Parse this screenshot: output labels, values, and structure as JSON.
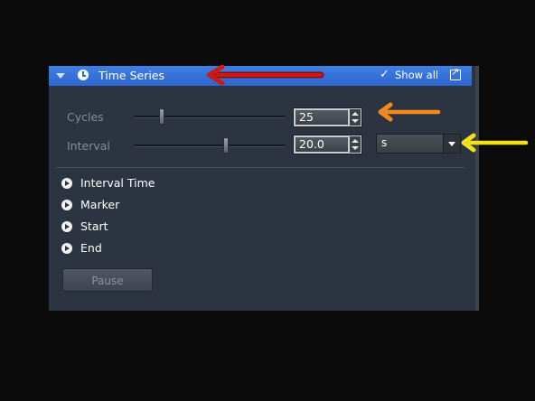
{
  "header": {
    "title": "Time Series",
    "show_all_check": "✓",
    "show_all_label": "Show all",
    "icons": [
      "collapse-triangle-icon",
      "clock-icon",
      "undock-icon"
    ]
  },
  "cycles": {
    "label": "Cycles",
    "value": "25"
  },
  "interval": {
    "label": "Interval",
    "value": "20.0",
    "unit": "s"
  },
  "sections": [
    {
      "label": "Interval Time"
    },
    {
      "label": "Marker"
    },
    {
      "label": "Start"
    },
    {
      "label": "End"
    }
  ],
  "pause_label": "Pause",
  "colors": {
    "header": "#2d66cf",
    "panel": "#2c3442",
    "arrow_red": "#cc1a1a",
    "arrow_orange": "#f38a1e",
    "arrow_yellow": "#f2e11a"
  }
}
